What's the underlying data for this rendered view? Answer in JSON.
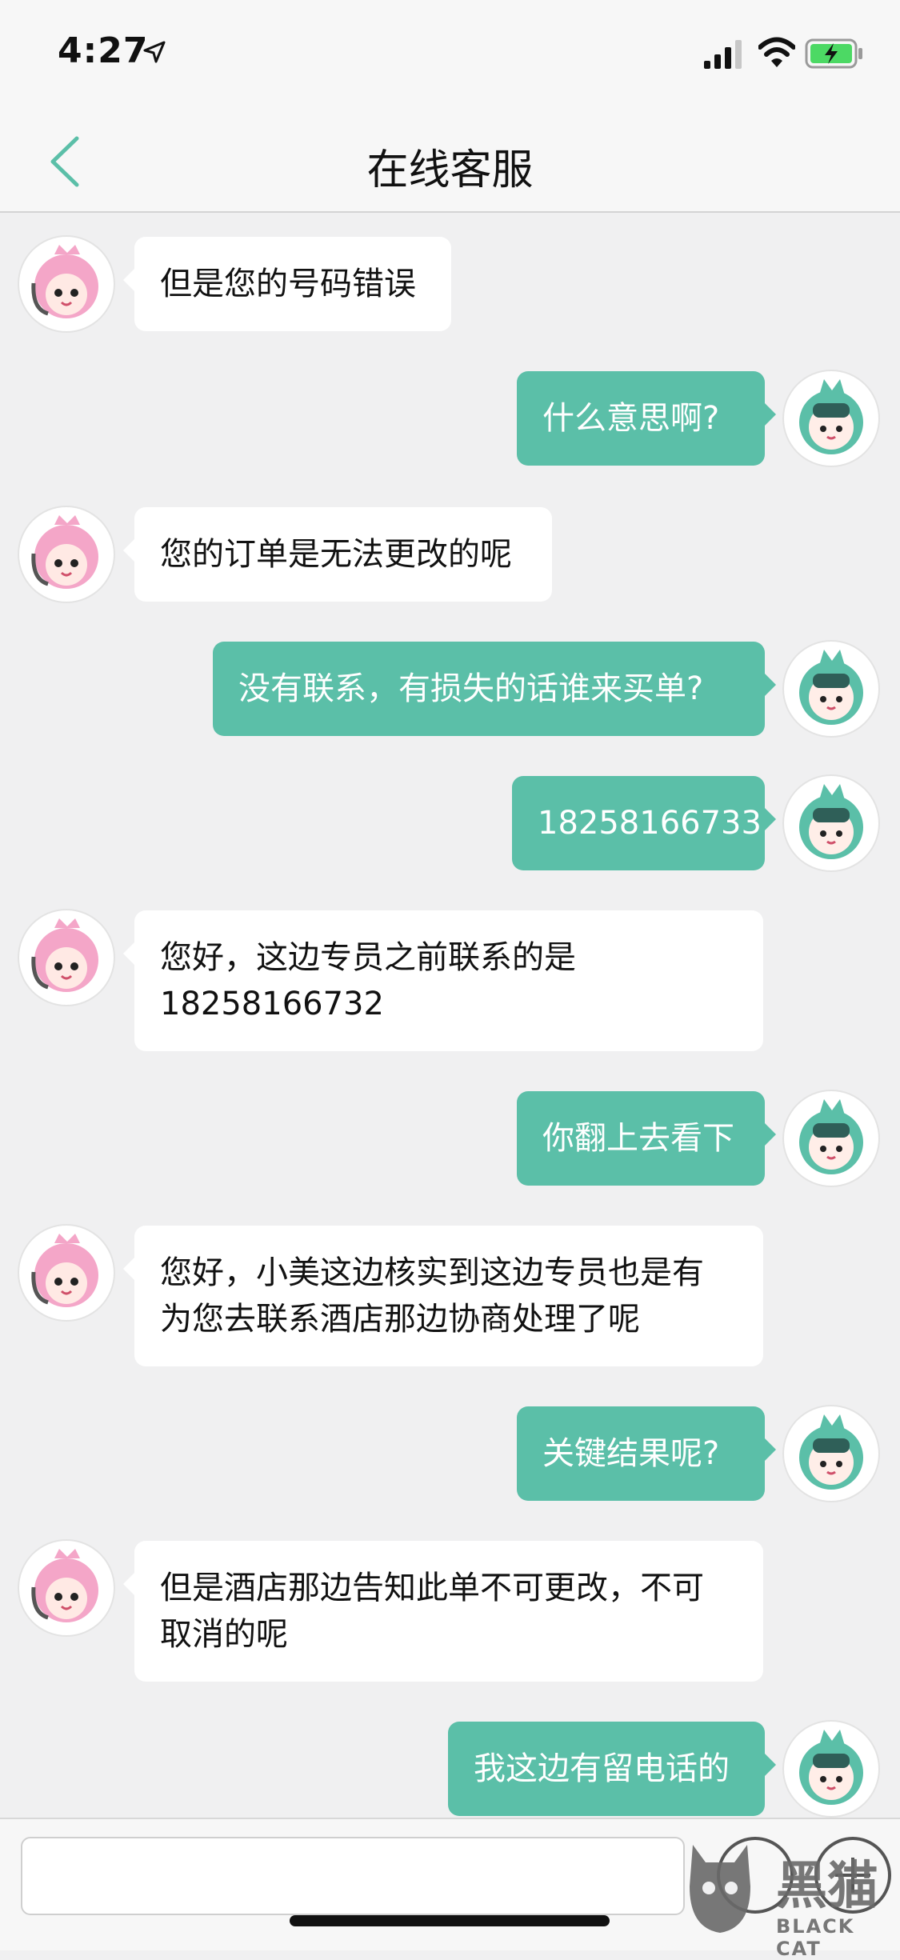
{
  "status_bar": {
    "time": "4:27"
  },
  "header": {
    "title": "在线客服"
  },
  "messages": [
    {
      "sender": "agent",
      "lines": [
        "但是您的号码错误"
      ]
    },
    {
      "sender": "user",
      "lines": [
        "什么意思啊?"
      ]
    },
    {
      "sender": "agent",
      "lines": [
        "您的订单是无法更改的呢"
      ]
    },
    {
      "sender": "user",
      "lines": [
        "没有联系，有损失的话谁来买单?"
      ]
    },
    {
      "sender": "user",
      "lines": [
        "18258166733"
      ]
    },
    {
      "sender": "agent",
      "lines": [
        "您好，这边专员之前联系的是",
        "18258166732"
      ]
    },
    {
      "sender": "user",
      "lines": [
        "你翻上去看下"
      ]
    },
    {
      "sender": "agent",
      "lines": [
        "您好，小美这边核实到这边专员也是有",
        "为您去联系酒店那边协商处理了呢"
      ]
    },
    {
      "sender": "user",
      "lines": [
        "关键结果呢?"
      ]
    },
    {
      "sender": "agent",
      "lines": [
        "但是酒店那边告知此单不可更改，不可",
        "取消的呢"
      ]
    },
    {
      "sender": "user",
      "lines": [
        "我这边有留电话的"
      ]
    }
  ],
  "input": {
    "value": "",
    "placeholder": ""
  },
  "icons": {
    "back": "chevron-left-icon",
    "agent_avatar": "agent-avatar-icon",
    "user_avatar": "user-avatar-icon",
    "emoji": "emoji-icon",
    "add": "plus-icon"
  },
  "colors": {
    "accent": "#5bbfa8",
    "agent_bubble": "#ffffff",
    "background": "#f0f0f1",
    "back_chevron": "#5bbfa8"
  },
  "watermark": {
    "text": "黑猫",
    "sub": "BLACK CAT"
  }
}
